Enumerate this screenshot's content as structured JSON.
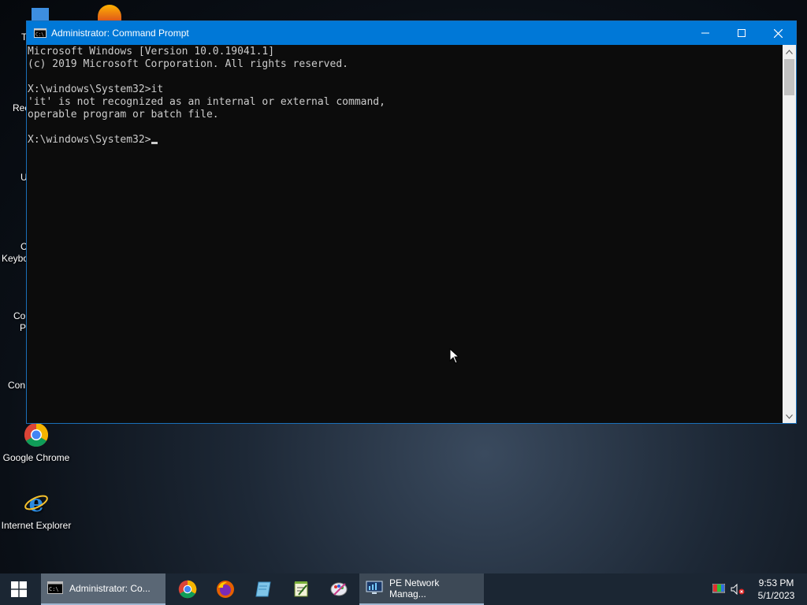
{
  "desktop": {
    "icons": [
      {
        "label": "Google Chrome"
      },
      {
        "label": "Internet Explorer"
      }
    ],
    "partial_labels": [
      "T",
      "Rec",
      "U",
      "C",
      "Keybo",
      "Co",
      "P",
      "Con"
    ]
  },
  "window": {
    "title": "Administrator: Command Prompt",
    "lines": [
      "Microsoft Windows [Version 10.0.19041.1]",
      "(c) 2019 Microsoft Corporation. All rights reserved.",
      "",
      "X:\\windows\\System32>it",
      "'it' is not recognized as an internal or external command,",
      "operable program or batch file.",
      "",
      "X:\\windows\\System32>"
    ]
  },
  "taskbar": {
    "tasks": [
      {
        "label": "Administrator: Co..."
      },
      {
        "label": "PE Network Manag..."
      }
    ],
    "clock": {
      "time": "9:53 PM",
      "date": "5/1/2023"
    }
  },
  "colors": {
    "titlebar": "#0078d7",
    "console_bg": "#0c0c0c",
    "console_fg": "#cccccc",
    "taskbar": "#1b2633"
  }
}
